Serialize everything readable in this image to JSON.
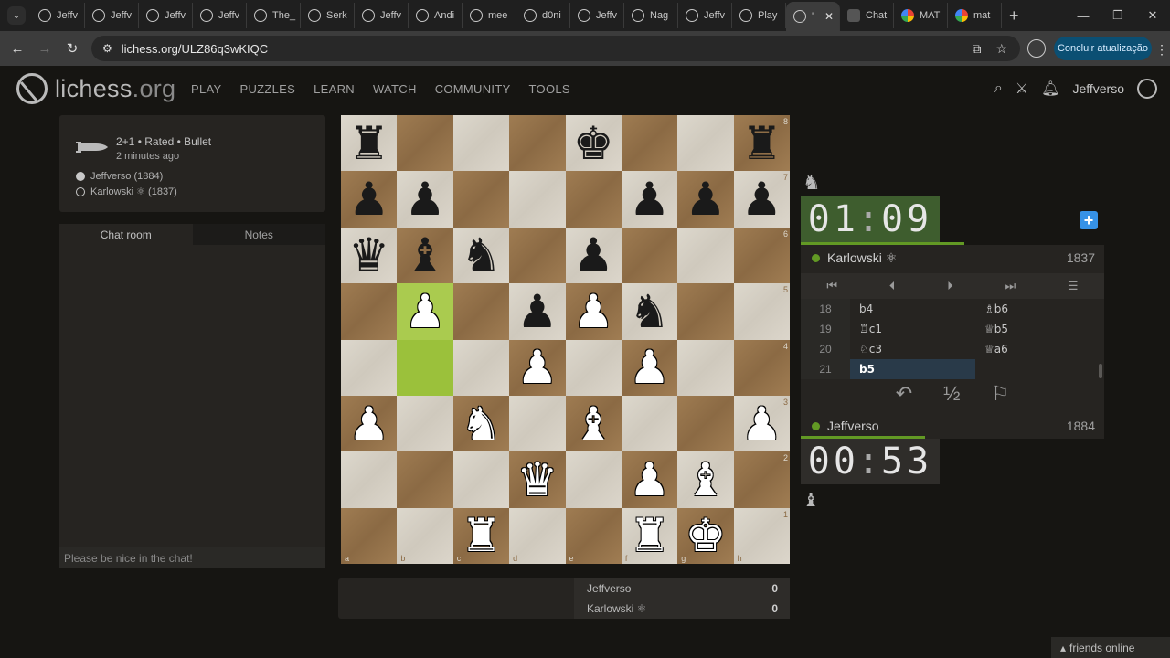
{
  "browser": {
    "tabs": [
      {
        "label": "Jeffv",
        "icon": "lichess-icon"
      },
      {
        "label": "Jeffv",
        "icon": "lichess-icon"
      },
      {
        "label": "Jeffv",
        "icon": "lichess-icon"
      },
      {
        "label": "Jeffv",
        "icon": "lichess-icon"
      },
      {
        "label": "The_",
        "icon": "lichess-icon"
      },
      {
        "label": "Serk",
        "icon": "lichess-icon"
      },
      {
        "label": "Jeffv",
        "icon": "lichess-icon"
      },
      {
        "label": "Andi",
        "icon": "lichess-icon"
      },
      {
        "label": "mee",
        "icon": "lichess-icon"
      },
      {
        "label": "d0ni",
        "icon": "lichess-icon"
      },
      {
        "label": "Jeffv",
        "icon": "lichess-icon"
      },
      {
        "label": "Nag",
        "icon": "lichess-icon"
      },
      {
        "label": "Jeffv",
        "icon": "lichess-icon"
      },
      {
        "label": "Play",
        "icon": "lichess-icon"
      },
      {
        "label": "'",
        "icon": "lichess-icon",
        "active": true
      },
      {
        "label": "Chat",
        "icon": "chat-icon"
      },
      {
        "label": "MAT",
        "icon": "google-icon"
      },
      {
        "label": "mat",
        "icon": "google-icon"
      }
    ],
    "url": "lichess.org/ULZ86q3wKIQC",
    "update_button": "Concluir atualização"
  },
  "header": {
    "logo": "lichess",
    "logo_tld": ".org",
    "nav": [
      "PLAY",
      "PUZZLES",
      "LEARN",
      "WATCH",
      "COMMUNITY",
      "TOOLS"
    ],
    "username": "Jeffverso"
  },
  "game_info": {
    "mode": "2+1 • Rated • Bullet",
    "time_ago": "2 minutes ago",
    "white_player": "Jeffverso (1884)",
    "black_player": "Karlowski ⚛ (1837)"
  },
  "chat": {
    "tabs": [
      "Chat room",
      "Notes"
    ],
    "placeholder": "Please be nice in the chat!"
  },
  "board": {
    "highlight_squares": [
      "b5",
      "b4"
    ],
    "ranks": [
      "8",
      "7",
      "6",
      "5",
      "4",
      "3",
      "2",
      "1"
    ],
    "files": [
      "a",
      "b",
      "c",
      "d",
      "e",
      "f",
      "g",
      "h"
    ],
    "position": [
      [
        "bR",
        "",
        "",
        "",
        "bK",
        "",
        "",
        "bR"
      ],
      [
        "bP",
        "bP",
        "",
        "",
        "",
        "bP",
        "bP",
        "bP"
      ],
      [
        "bQ",
        "bB",
        "bN",
        "",
        "bP",
        "",
        "",
        ""
      ],
      [
        "",
        "wP",
        "",
        "bP",
        "wP",
        "bN",
        "",
        ""
      ],
      [
        "",
        "",
        "",
        "wP",
        "",
        "wP",
        "",
        ""
      ],
      [
        "wP",
        "",
        "wN",
        "",
        "wB",
        "",
        "",
        "wP"
      ],
      [
        "",
        "",
        "",
        "wQ",
        "",
        "wP",
        "wB",
        ""
      ],
      [
        "",
        "",
        "wR",
        "",
        "",
        "wR",
        "wK",
        ""
      ]
    ]
  },
  "material": {
    "rows": [
      {
        "name": "Jeffverso",
        "score": "0"
      },
      {
        "name": "Karlowski ⚛",
        "score": "0"
      }
    ]
  },
  "opponent": {
    "clock_min": "01",
    "clock_sec": "09",
    "name": "Karlowski ⚛",
    "rating": "1837",
    "time_fraction": 0.54
  },
  "player": {
    "clock_min": "00",
    "clock_sec": "53",
    "name": "Jeffverso",
    "rating": "1884",
    "time_fraction": 0.41
  },
  "moves": [
    {
      "n": "18",
      "w": "b4",
      "b": "♗b6"
    },
    {
      "n": "19",
      "w": "♖c1",
      "b": "♕b5"
    },
    {
      "n": "20",
      "w": "♘c3",
      "b": "♕a6"
    },
    {
      "n": "21",
      "w": "b5",
      "b": ""
    }
  ],
  "footer": {
    "friends": "friends online"
  }
}
